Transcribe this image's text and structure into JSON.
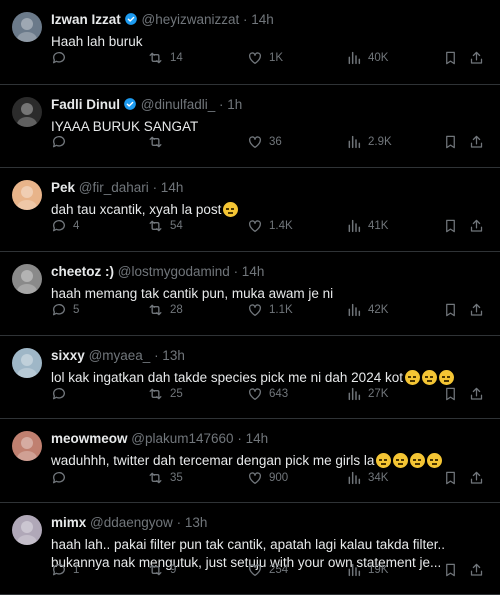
{
  "tweets": [
    {
      "name": "Izwan Izzat",
      "verified": true,
      "handle": "@heyizwanizzat",
      "time": "· 14h",
      "text": "Haah lah buruk",
      "emoji_count": 0,
      "text2": "",
      "replies": "",
      "retweets": "14",
      "likes": "1K",
      "views": "40K",
      "avatar_color": "#6b7a8a"
    },
    {
      "name": "Fadli Dinul",
      "verified": true,
      "handle": "@dinulfadli_",
      "time": "· 1h",
      "text": "IYAAA BURUK SANGAT",
      "emoji_count": 0,
      "text2": "",
      "replies": "",
      "retweets": "",
      "likes": "36",
      "views": "2.9K",
      "avatar_color": "#2b2b2b"
    },
    {
      "name": "Pek",
      "verified": false,
      "handle": "@fir_dahari",
      "time": "· 14h",
      "text": "dah tau xcantik, xyah la post",
      "emoji_count": 1,
      "text2": "",
      "replies": "4",
      "retweets": "54",
      "likes": "1.4K",
      "views": "41K",
      "avatar_color": "#e8b48a"
    },
    {
      "name": "cheetoz :)",
      "verified": false,
      "handle": "@lostmygodamind",
      "time": "· 14h",
      "text": "haah memang tak cantik pun, muka awam je ni",
      "emoji_count": 0,
      "text2": "",
      "replies": "5",
      "retweets": "28",
      "likes": "1.1K",
      "views": "42K",
      "avatar_color": "#8a8a8a"
    },
    {
      "name": "sixxy",
      "verified": false,
      "handle": "@myaea_",
      "time": "· 13h",
      "text": "lol kak ingatkan dah takde species pick me ni dah 2024 kot",
      "emoji_count": 3,
      "text2": "",
      "replies": "",
      "retweets": "25",
      "likes": "643",
      "views": "27K",
      "avatar_color": "#9fb7c7"
    },
    {
      "name": "meowmeow",
      "verified": false,
      "handle": "@plakum147660",
      "time": "· 14h",
      "text": "waduhhh, twitter dah tercemar dengan pick me girls la",
      "emoji_count": 4,
      "text2": "",
      "replies": "",
      "retweets": "35",
      "likes": "900",
      "views": "34K",
      "avatar_color": "#c08070"
    },
    {
      "name": "mimx",
      "verified": false,
      "handle": "@ddaengyow",
      "time": "· 13h",
      "text": "haah lah.. pakai filter pun tak cantik, apatah lagi kalau takda filter..",
      "emoji_count": 0,
      "text2": "bukannya nak mengutuk, just setuju with your own statement je...",
      "replies": "1",
      "retweets": "9",
      "likes": "254",
      "views": "19K",
      "avatar_color": "#b0a8b8"
    }
  ],
  "colors": {
    "background": "#000000",
    "text": "#e7e9ea",
    "muted": "#71767b",
    "verified": "#1d9bf0",
    "divider": "#2f3336"
  }
}
